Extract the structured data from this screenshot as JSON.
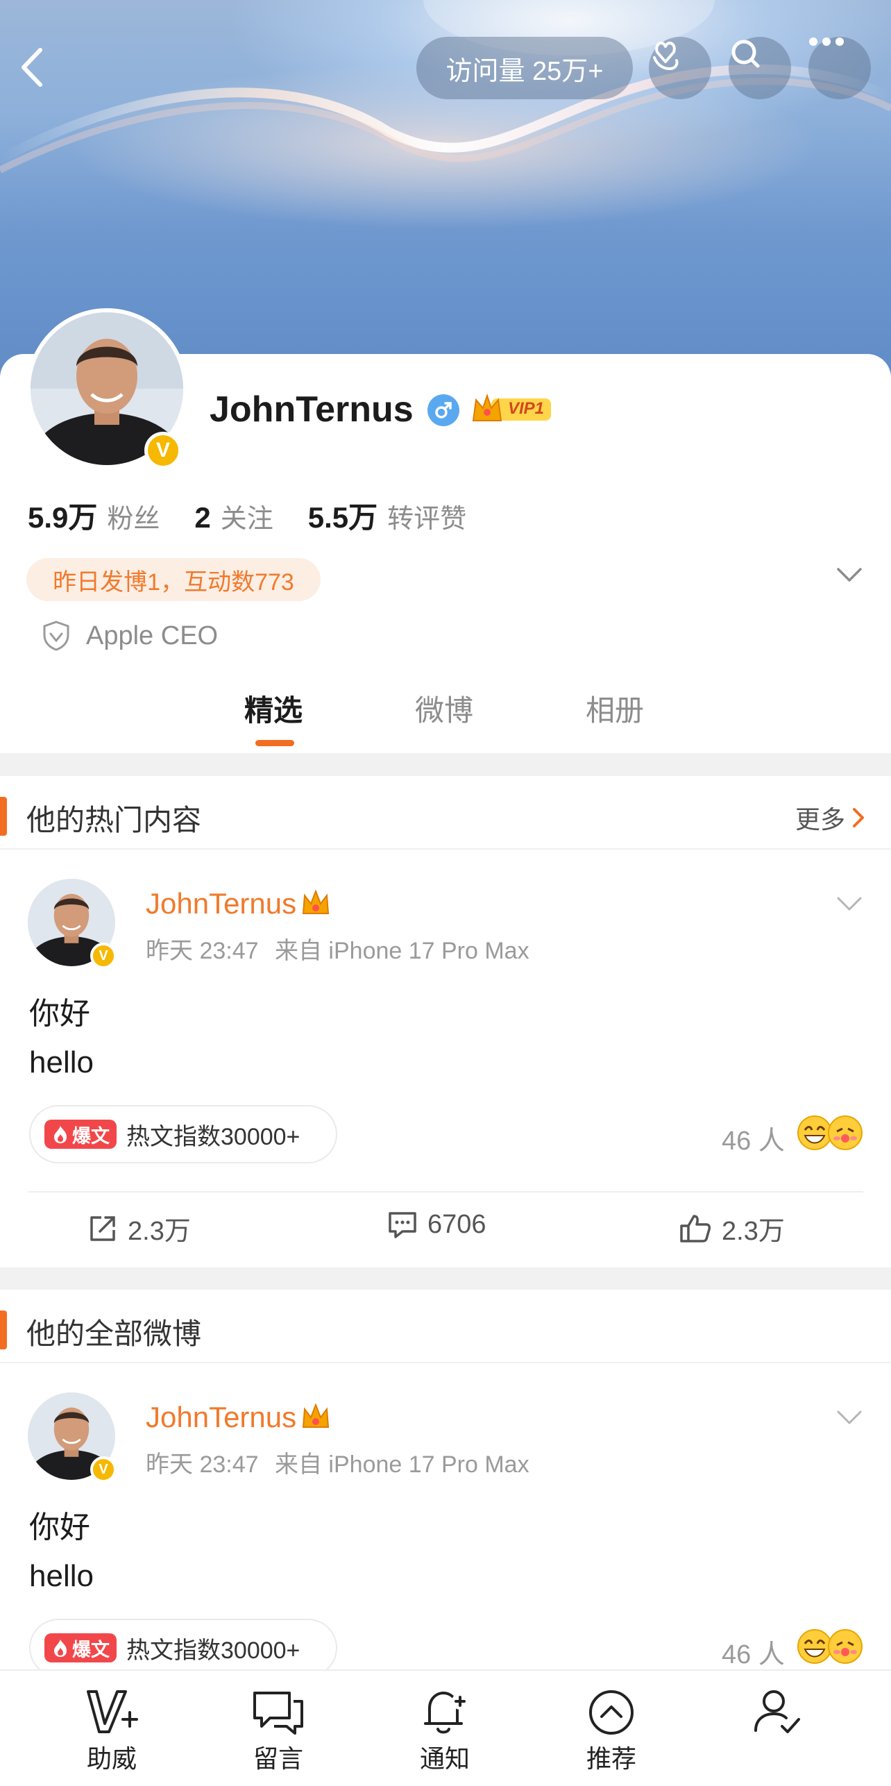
{
  "header": {
    "visit_label": "访问量 25万+",
    "icons": [
      "back-arrow-icon",
      "hand-heart-icon",
      "search-icon",
      "more-icon"
    ]
  },
  "profile": {
    "name": "JohnTernus",
    "vip_text": "VIP1",
    "stats": [
      {
        "num": "5.9万",
        "label": "粉丝"
      },
      {
        "num": "2",
        "label": "关注"
      },
      {
        "num": "5.5万",
        "label": "转评赞"
      }
    ],
    "activity": "昨日发博1，互动数773",
    "bio": "Apple CEO"
  },
  "tabs": [
    {
      "label": "精选",
      "active": true
    },
    {
      "label": "微博",
      "active": false
    },
    {
      "label": "相册",
      "active": false
    }
  ],
  "sections": {
    "hot_title": "他的热门内容",
    "more": "更多",
    "all_title": "他的全部微博"
  },
  "posts": [
    {
      "author": "JohnTernus",
      "time": "昨天 23:47",
      "source": "来自 iPhone 17 Pro Max",
      "line1": "你好",
      "line2": "hello",
      "hot_tag": "爆文",
      "hot_text": "热文指数30000+",
      "people": "46 人",
      "reposts": "2.3万",
      "comments": "6706",
      "likes": "2.3万"
    },
    {
      "author": "JohnTernus",
      "time": "昨天 23:47",
      "source": "来自 iPhone 17 Pro Max",
      "line1": "你好",
      "line2": "hello",
      "hot_tag": "爆文",
      "hot_text": "热文指数30000+",
      "people": "46 人"
    }
  ],
  "bottom_nav": [
    {
      "label": "助威",
      "icon": "cheer-v-icon"
    },
    {
      "label": "留言",
      "icon": "message-icon"
    },
    {
      "label": "通知",
      "icon": "bell-plus-icon"
    },
    {
      "label": "推荐",
      "icon": "chevron-up-circle-icon"
    },
    {
      "label": "",
      "icon": "user-check-icon"
    }
  ],
  "colors": {
    "accent": "#f26d22",
    "name_orange": "#f07a2c",
    "gold": "#f6b800",
    "hot_red": "#f2474a"
  }
}
